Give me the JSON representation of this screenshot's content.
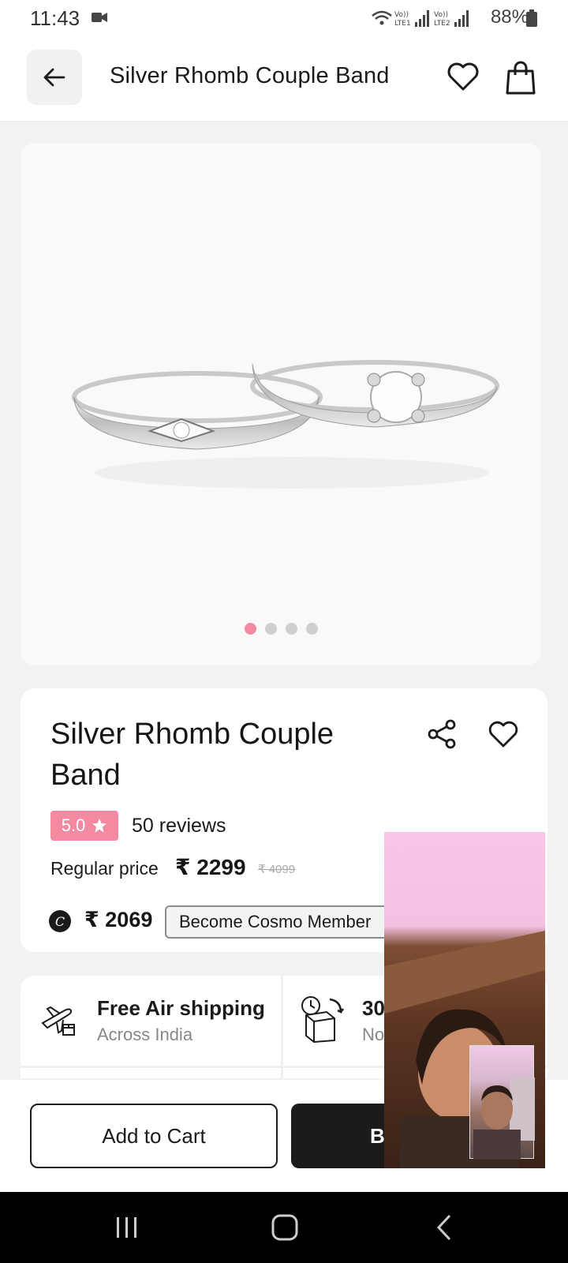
{
  "status_bar": {
    "time": "11:43",
    "battery": "88%",
    "icons": [
      "wifi-icon",
      "video-call-indicator-icon",
      "signal-lte1-icon",
      "signal-lte2-icon",
      "battery-icon"
    ]
  },
  "header": {
    "title": "Silver Rhomb Couple Band",
    "icons": [
      "back-arrow-icon",
      "heart-outline-icon",
      "shopping-bag-icon"
    ]
  },
  "gallery": {
    "image_alt": "Silver Rhomb Couple Band rings",
    "dot_count": 4,
    "active_dot": 0,
    "accent_color": "#f48aa1"
  },
  "product": {
    "title": "Silver Rhomb Couple Band",
    "rating": "5.0",
    "reviews": "50 reviews",
    "regular_price_label": "Regular price",
    "price": "₹ 2299",
    "original_price": "₹ 4099",
    "member_price": "₹ 2069",
    "member_button": "Become Cosmo Member",
    "cosmo_badge": "C"
  },
  "features": [
    {
      "title": "Free Air shipping",
      "subtitle": "Across India",
      "icon": "airplane-package-icon"
    },
    {
      "title": "30",
      "subtitle": "No",
      "icon": "return-box-clock-icon"
    }
  ],
  "actions": {
    "add_to_cart": "Add to Cart",
    "buy_now_visible": "B"
  },
  "colors": {
    "accent": "#f48aa1",
    "dark": "#1b1b1b",
    "background": "#f2f2f2"
  }
}
